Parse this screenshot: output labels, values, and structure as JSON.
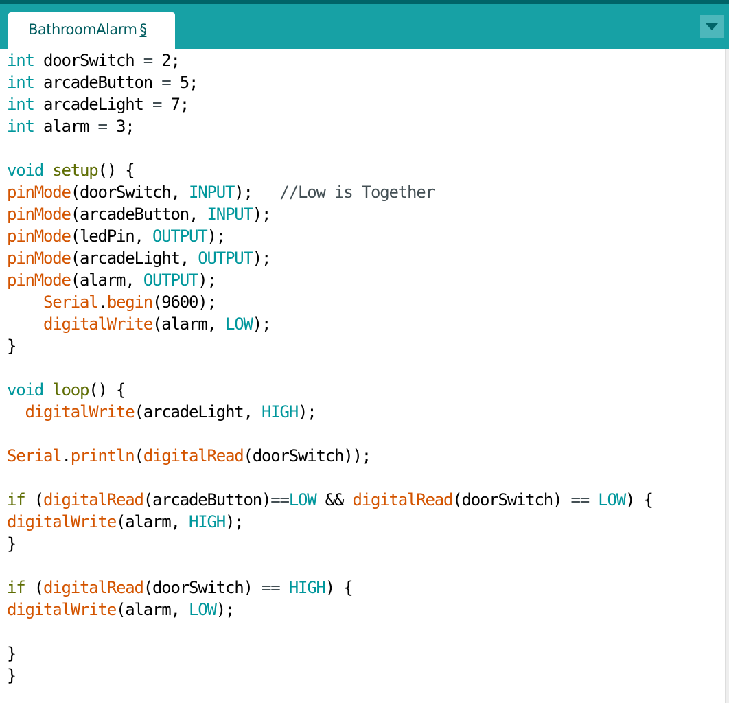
{
  "window": {
    "tab": {
      "name": "BathroomAlarm",
      "modified_marker": "§"
    },
    "menu_icon": "triangle-down-icon"
  },
  "colors": {
    "header_bg": "#17a1a5",
    "header_top": "#006468",
    "keyword": "#00979c",
    "function": "#d35400",
    "control": "#5e6d03",
    "comment": "#434f54"
  },
  "code": [
    [
      [
        "kw",
        "int"
      ],
      [
        "tx",
        " doorSwitch "
      ],
      [
        "op",
        "="
      ],
      [
        "tx",
        " 2;"
      ]
    ],
    [
      [
        "kw",
        "int"
      ],
      [
        "tx",
        " arcadeButton "
      ],
      [
        "op",
        "="
      ],
      [
        "tx",
        " 5;"
      ]
    ],
    [
      [
        "kw",
        "int"
      ],
      [
        "tx",
        " arcadeLight "
      ],
      [
        "op",
        "="
      ],
      [
        "tx",
        " 7;"
      ]
    ],
    [
      [
        "kw",
        "int"
      ],
      [
        "tx",
        " alarm "
      ],
      [
        "op",
        "="
      ],
      [
        "tx",
        " 3;"
      ]
    ],
    [],
    [
      [
        "kw",
        "void"
      ],
      [
        "tx",
        " "
      ],
      [
        "ctl",
        "setup"
      ],
      [
        "tx",
        "() {"
      ]
    ],
    [
      [
        "fn",
        "pinMode"
      ],
      [
        "tx",
        "(doorSwitch, "
      ],
      [
        "kw",
        "INPUT"
      ],
      [
        "tx",
        ");   "
      ],
      [
        "cm",
        "//Low is Together"
      ]
    ],
    [
      [
        "fn",
        "pinMode"
      ],
      [
        "tx",
        "(arcadeButton, "
      ],
      [
        "kw",
        "INPUT"
      ],
      [
        "tx",
        ");"
      ]
    ],
    [
      [
        "fn",
        "pinMode"
      ],
      [
        "tx",
        "(ledPin, "
      ],
      [
        "kw",
        "OUTPUT"
      ],
      [
        "tx",
        ");"
      ]
    ],
    [
      [
        "fn",
        "pinMode"
      ],
      [
        "tx",
        "(arcadeLight, "
      ],
      [
        "kw",
        "OUTPUT"
      ],
      [
        "tx",
        ");"
      ]
    ],
    [
      [
        "fn",
        "pinMode"
      ],
      [
        "tx",
        "(alarm, "
      ],
      [
        "kw",
        "OUTPUT"
      ],
      [
        "tx",
        ");"
      ]
    ],
    [
      [
        "tx",
        "    "
      ],
      [
        "fn",
        "Serial"
      ],
      [
        "tx",
        "."
      ],
      [
        "fn",
        "begin"
      ],
      [
        "tx",
        "(9600);"
      ]
    ],
    [
      [
        "tx",
        "    "
      ],
      [
        "fn",
        "digitalWrite"
      ],
      [
        "tx",
        "(alarm, "
      ],
      [
        "kw",
        "LOW"
      ],
      [
        "tx",
        ");"
      ]
    ],
    [
      [
        "tx",
        "}"
      ]
    ],
    [],
    [
      [
        "kw",
        "void"
      ],
      [
        "tx",
        " "
      ],
      [
        "ctl",
        "loop"
      ],
      [
        "tx",
        "() {"
      ]
    ],
    [
      [
        "tx",
        "  "
      ],
      [
        "fn",
        "digitalWrite"
      ],
      [
        "tx",
        "(arcadeLight, "
      ],
      [
        "kw",
        "HIGH"
      ],
      [
        "tx",
        ");"
      ]
    ],
    [],
    [
      [
        "fn",
        "Serial"
      ],
      [
        "tx",
        "."
      ],
      [
        "fn",
        "println"
      ],
      [
        "tx",
        "("
      ],
      [
        "fn",
        "digitalRead"
      ],
      [
        "tx",
        "(doorSwitch));"
      ]
    ],
    [],
    [
      [
        "ctl",
        "if"
      ],
      [
        "tx",
        " ("
      ],
      [
        "fn",
        "digitalRead"
      ],
      [
        "tx",
        "(arcadeButton)"
      ],
      [
        "op",
        "=="
      ],
      [
        "kw",
        "LOW"
      ],
      [
        "tx",
        " && "
      ],
      [
        "fn",
        "digitalRead"
      ],
      [
        "tx",
        "(doorSwitch) "
      ],
      [
        "op",
        "=="
      ],
      [
        "tx",
        " "
      ],
      [
        "kw",
        "LOW"
      ],
      [
        "tx",
        ") {"
      ]
    ],
    [
      [
        "fn",
        "digitalWrite"
      ],
      [
        "tx",
        "(alarm, "
      ],
      [
        "kw",
        "HIGH"
      ],
      [
        "tx",
        ");"
      ]
    ],
    [
      [
        "tx",
        "}"
      ]
    ],
    [],
    [
      [
        "ctl",
        "if"
      ],
      [
        "tx",
        " ("
      ],
      [
        "fn",
        "digitalRead"
      ],
      [
        "tx",
        "(doorSwitch) "
      ],
      [
        "op",
        "=="
      ],
      [
        "tx",
        " "
      ],
      [
        "kw",
        "HIGH"
      ],
      [
        "tx",
        ") {"
      ]
    ],
    [
      [
        "fn",
        "digitalWrite"
      ],
      [
        "tx",
        "(alarm, "
      ],
      [
        "kw",
        "LOW"
      ],
      [
        "tx",
        ");"
      ]
    ],
    [],
    [
      [
        "tx",
        "}"
      ]
    ],
    [
      [
        "tx",
        "}"
      ]
    ]
  ]
}
